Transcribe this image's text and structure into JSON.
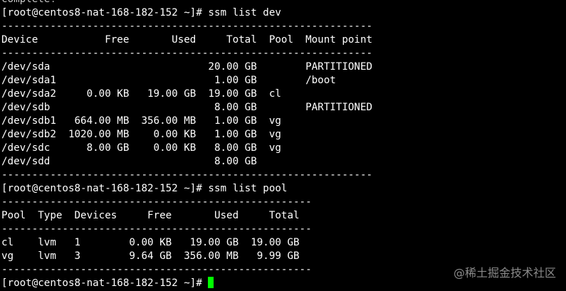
{
  "terminal": {
    "cursor_color": "#00ff00",
    "text_color": "#ffffff",
    "background": "#000000",
    "lines": [
      "complete!",
      "[root@centos8-nat-168-182-152 ~]# ssm list dev",
      "-------------------------------------------------------------",
      "Device           Free       Used     Total  Pool  Mount point",
      "-------------------------------------------------------------",
      "/dev/sda                          20.00 GB        PARTITIONED",
      "/dev/sda1                          1.00 GB        /boot",
      "/dev/sda2     0.00 KB   19.00 GB  19.00 GB  cl",
      "/dev/sdb                           8.00 GB        PARTITIONED",
      "/dev/sdb1   664.00 MB  356.00 MB   1.00 GB  vg",
      "/dev/sdb2  1020.00 MB    0.00 KB   1.00 GB  vg",
      "/dev/sdc      8.00 GB    0.00 KB   8.00 GB  vg",
      "/dev/sdd                           8.00 GB",
      "-------------------------------------------------------------",
      "[root@centos8-nat-168-182-152 ~]# ssm list pool",
      "---------------------------------------------------",
      "Pool  Type  Devices     Free       Used     Total",
      "---------------------------------------------------",
      "cl    lvm   1        0.00 KB   19.00 GB  19.00 GB",
      "vg    lvm   3        9.64 GB  356.00 MB   9.99 GB",
      "---------------------------------------------------"
    ],
    "prompt": "[root@centos8-nat-168-182-152 ~]# "
  },
  "watermark": "@稀土掘金技术社区"
}
